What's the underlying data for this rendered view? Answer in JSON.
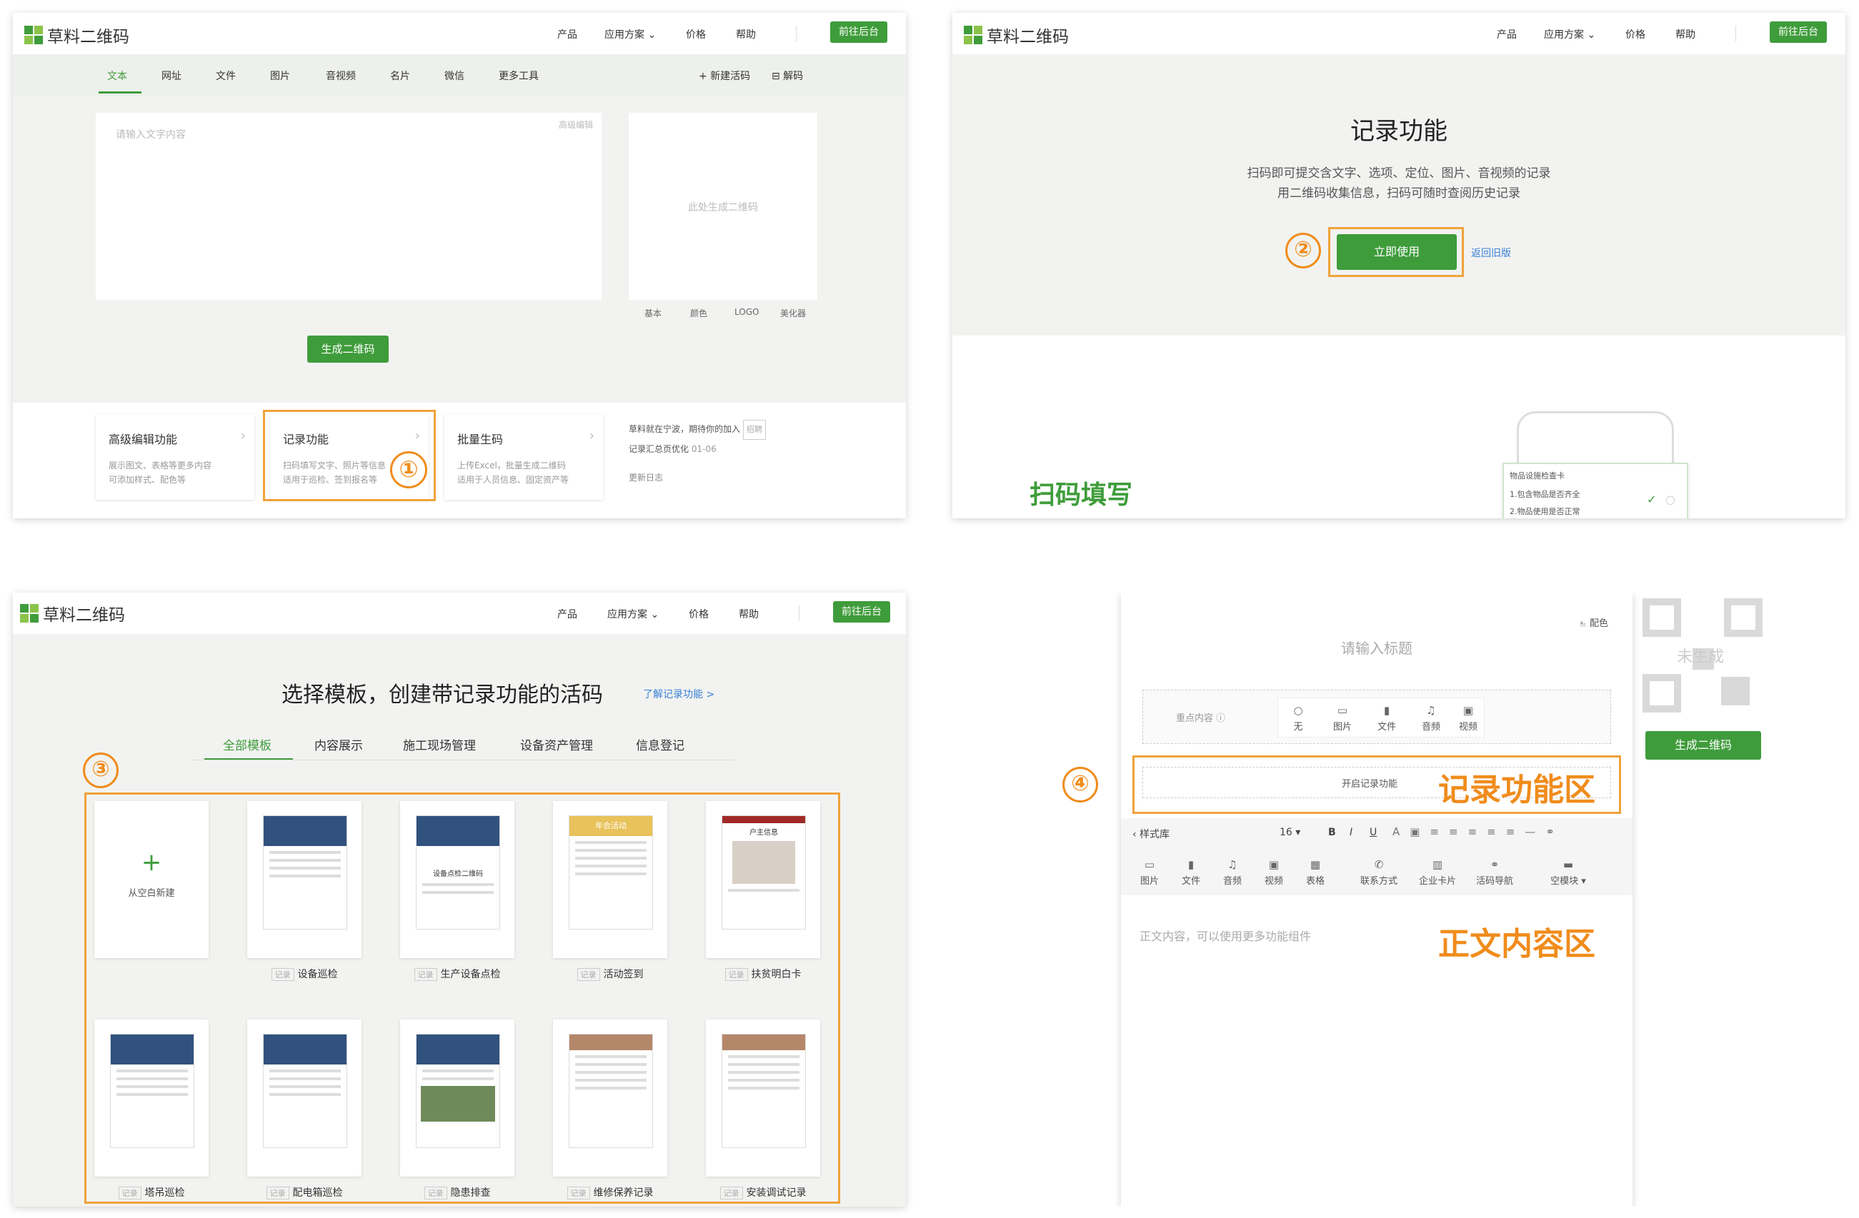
{
  "brand": {
    "name": "草料二维码",
    "accent": "#3f9c3b",
    "highlight": "#f0a23a"
  },
  "nav": {
    "product": "产品",
    "solutions": "应用方案 ⌄",
    "pricing": "价格",
    "help": "帮助",
    "backend": "前往后台"
  },
  "panel1": {
    "tabs": [
      "文本",
      "网址",
      "文件",
      "图片",
      "音视频",
      "名片",
      "微信",
      "更多工具"
    ],
    "new_code": "+ 新建活码",
    "decode": "⊟ 解码",
    "text_placeholder": "请输入文字内容",
    "advanced_edit": "高级编辑",
    "qr_placeholder": "此处生成二维码",
    "qr_tabs": [
      "基本",
      "颜色",
      "LOGO",
      "美化器"
    ],
    "generate": "生成二维码",
    "features": [
      {
        "title": "高级编辑功能",
        "desc1": "展示图文、表格等更多内容",
        "desc2": "可添加样式、配色等"
      },
      {
        "title": "记录功能",
        "desc1": "扫码填写文字、照片等信息",
        "desc2": "适用于巡检、签到报名等"
      },
      {
        "title": "批量生码",
        "desc1": "上传Excel，批量生成二维码",
        "desc2": "适用于人员信息、固定资产等"
      }
    ],
    "news1": "草料就在宁波，期待你的加入",
    "news1_badge": "招聘",
    "news2": "记录汇总页优化",
    "news2_date": "01-06",
    "changelog": "更新日志",
    "step": "①"
  },
  "panel2": {
    "title": "记录功能",
    "desc1": "扫码即可提交含文字、选项、定位、图片、音视频的记录",
    "desc2": "用二维码收集信息，扫码可随时查阅历史记录",
    "cta": "立即使用",
    "back": "返回旧版",
    "step": "②",
    "scan_fill": "扫码填写",
    "checklist_title": "物品设施检查卡",
    "checklist_1": "1.包含物品是否齐全",
    "checklist_2": "2.物品使用是否正常"
  },
  "panel3": {
    "title": "选择模板，创建带记录功能的活码",
    "learn_more": "了解记录功能 >",
    "tabs": [
      "全部模板",
      "内容展示",
      "施工现场管理",
      "设备资产管理",
      "信息登记"
    ],
    "new_blank": "从空白新建",
    "tag": "记录",
    "templates": [
      "设备巡检",
      "生产设备点检",
      "活动签到",
      "扶贫明白卡",
      "塔吊巡检",
      "配电箱巡检",
      "隐患排查",
      "维修保养记录",
      "安装调试记录"
    ],
    "card_texts": [
      "设备点检二维码",
      "年会活动",
      "户主信息"
    ],
    "step": "③"
  },
  "panel4": {
    "color_scheme": "⎁ 配色",
    "title_placeholder": "请输入标题",
    "key_content": "重点内容 ⓘ",
    "media": [
      "无",
      "图片",
      "文件",
      "音频",
      "视频"
    ],
    "record_toggle": "开启记录功能",
    "record_zone": "记录功能区",
    "toolbar": [
      "‹ 样式库",
      "16 ▾",
      "B",
      "I",
      "U"
    ],
    "inserts": [
      "图片",
      "文件",
      "音频",
      "视频",
      "表格",
      "联系方式",
      "企业卡片",
      "活码导航",
      "空模块 ▾"
    ],
    "body_placeholder": "正文内容，可以使用更多功能组件",
    "body_zone": "正文内容区",
    "qr_status": "未生成",
    "generate": "生成二维码",
    "step": "④"
  }
}
